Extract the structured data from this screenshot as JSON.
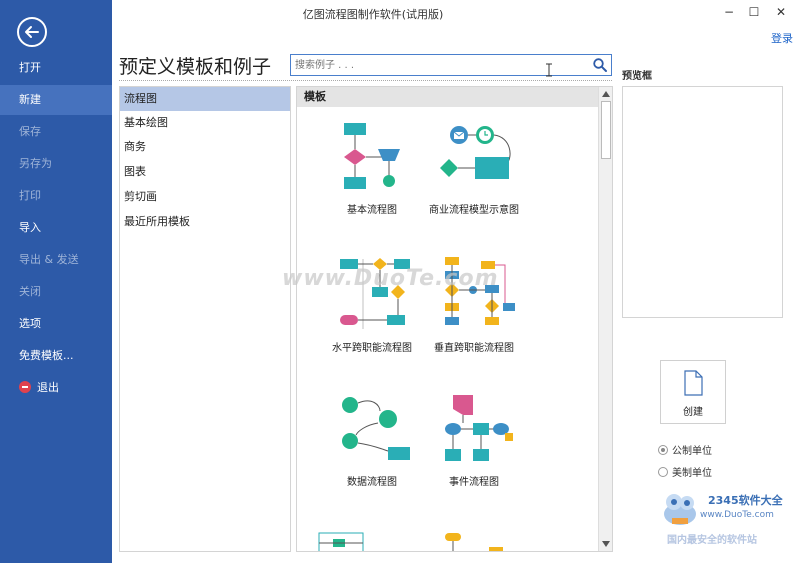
{
  "window": {
    "title": "亿图流程图制作软件(试用版)",
    "controls": {
      "minimize": "−",
      "maximize": "☐",
      "close": "✕"
    },
    "login": "登录"
  },
  "sidebar": {
    "items": [
      {
        "label": "打开",
        "state": "normal"
      },
      {
        "label": "新建",
        "state": "active"
      },
      {
        "label": "保存",
        "state": "disabled"
      },
      {
        "label": "另存为",
        "state": "disabled"
      },
      {
        "label": "打印",
        "state": "disabled"
      },
      {
        "label": "导入",
        "state": "normal"
      },
      {
        "label": "导出 & 发送",
        "state": "disabled"
      },
      {
        "label": "关闭",
        "state": "disabled"
      },
      {
        "label": "选项",
        "state": "normal"
      },
      {
        "label": "免费模板...",
        "state": "normal"
      },
      {
        "label": "退出",
        "state": "normal"
      }
    ]
  },
  "main": {
    "heading": "预定义模板和例子",
    "search": {
      "placeholder": "搜索例子 . . .",
      "value": ""
    }
  },
  "categories": [
    {
      "label": "流程图",
      "selected": true
    },
    {
      "label": "基本绘图",
      "selected": false
    },
    {
      "label": "商务",
      "selected": false
    },
    {
      "label": "图表",
      "selected": false
    },
    {
      "label": "剪切画",
      "selected": false
    },
    {
      "label": "最近所用模板",
      "selected": false
    }
  ],
  "templates": {
    "header": "模板",
    "items": [
      {
        "label": "基本流程图"
      },
      {
        "label": "商业流程模型示意图"
      },
      {
        "label": "水平跨职能流程图"
      },
      {
        "label": "垂直跨职能流程图"
      },
      {
        "label": "数据流程图"
      },
      {
        "label": "事件流程图"
      }
    ]
  },
  "preview": {
    "label": "预览框",
    "create_label": "创建",
    "units": [
      {
        "label": "公制单位",
        "checked": true
      },
      {
        "label": "美制单位",
        "checked": false
      }
    ]
  },
  "watermarks": {
    "center": "www.DuoTe.com",
    "brand": "2345软件大全",
    "brand_url": "www.DuoTe.com",
    "brand_bottom": "国内最安全的软件站"
  },
  "colors": {
    "sidebar": "#2d5aa8",
    "sidebar_active": "#4672be",
    "teal": "#2aaeb6",
    "steel_blue": "#3d8fc6",
    "pink": "#d9588f",
    "green": "#23b58b",
    "yellow": "#f2b41c",
    "category_selected": "#b5c7e6"
  }
}
